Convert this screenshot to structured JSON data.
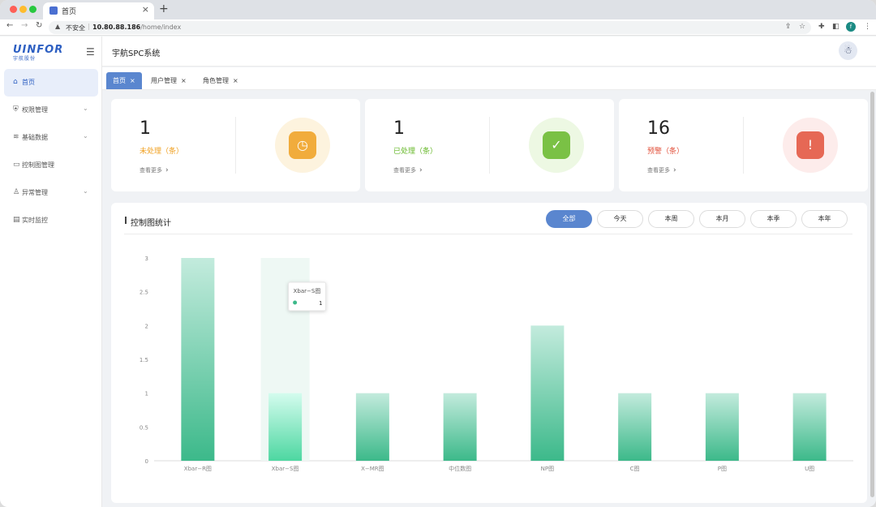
{
  "browser": {
    "tab_title": "首页",
    "tab_close": "×",
    "new_tab": "+",
    "security_label": "不安全",
    "url_host": "10.80.88.186",
    "url_path": "/home/index",
    "profile_initial": "f"
  },
  "sidebar": {
    "brand": "UINFOR",
    "brand_sub": "宇航股份",
    "items": [
      {
        "label": "首页",
        "icon": "home-icon",
        "active": true
      },
      {
        "label": "权限管理",
        "icon": "shield-icon",
        "has_children": true
      },
      {
        "label": "基础数据",
        "icon": "layers-icon",
        "has_children": true
      },
      {
        "label": "控制图管理",
        "icon": "monitor-icon"
      },
      {
        "label": "异常管理",
        "icon": "user-alert-icon",
        "has_children": true
      },
      {
        "label": "实时监控",
        "icon": "clipboard-icon"
      }
    ]
  },
  "header": {
    "title": "宇航SPC系统"
  },
  "page_tabs": [
    {
      "label": "首页",
      "active": true
    },
    {
      "label": "用户管理"
    },
    {
      "label": "角色管理"
    }
  ],
  "cards": [
    {
      "count": "1",
      "caption": "未处理（条）",
      "more": "查看更多",
      "color": "#f0a020",
      "icon": "clipboard-clock-icon"
    },
    {
      "count": "1",
      "caption": "已处理（条）",
      "more": "查看更多",
      "color": "#67b82a",
      "icon": "bell-check-icon"
    },
    {
      "count": "16",
      "caption": "预警（条）",
      "more": "查看更多",
      "color": "#e2513b",
      "icon": "warning-chat-icon"
    }
  ],
  "chart_panel": {
    "title": "控制图统计",
    "filters": [
      "全部",
      "今天",
      "本周",
      "本月",
      "本季",
      "本年"
    ],
    "active_filter": "全部"
  },
  "chart_data": {
    "type": "bar",
    "categories": [
      "Xbar−R图",
      "Xbar−S图",
      "X−MR图",
      "中位数图",
      "NP图",
      "C图",
      "P图",
      "U图"
    ],
    "values": [
      3,
      1,
      1,
      1,
      2,
      1,
      1,
      1
    ],
    "ylim": [
      0,
      3
    ],
    "yticks": [
      "0",
      "0.5",
      "1",
      "1.5",
      "2",
      "2.5",
      "3"
    ],
    "hovered_index": 1,
    "tooltip": {
      "title": "Xbar−S图",
      "value": "1"
    },
    "bar_color_top": "#c3ebdd",
    "bar_color_bottom": "#3cb98a",
    "highlight_color_top": "#d4fcee",
    "highlight_color_bottom": "#4dd7a1"
  }
}
